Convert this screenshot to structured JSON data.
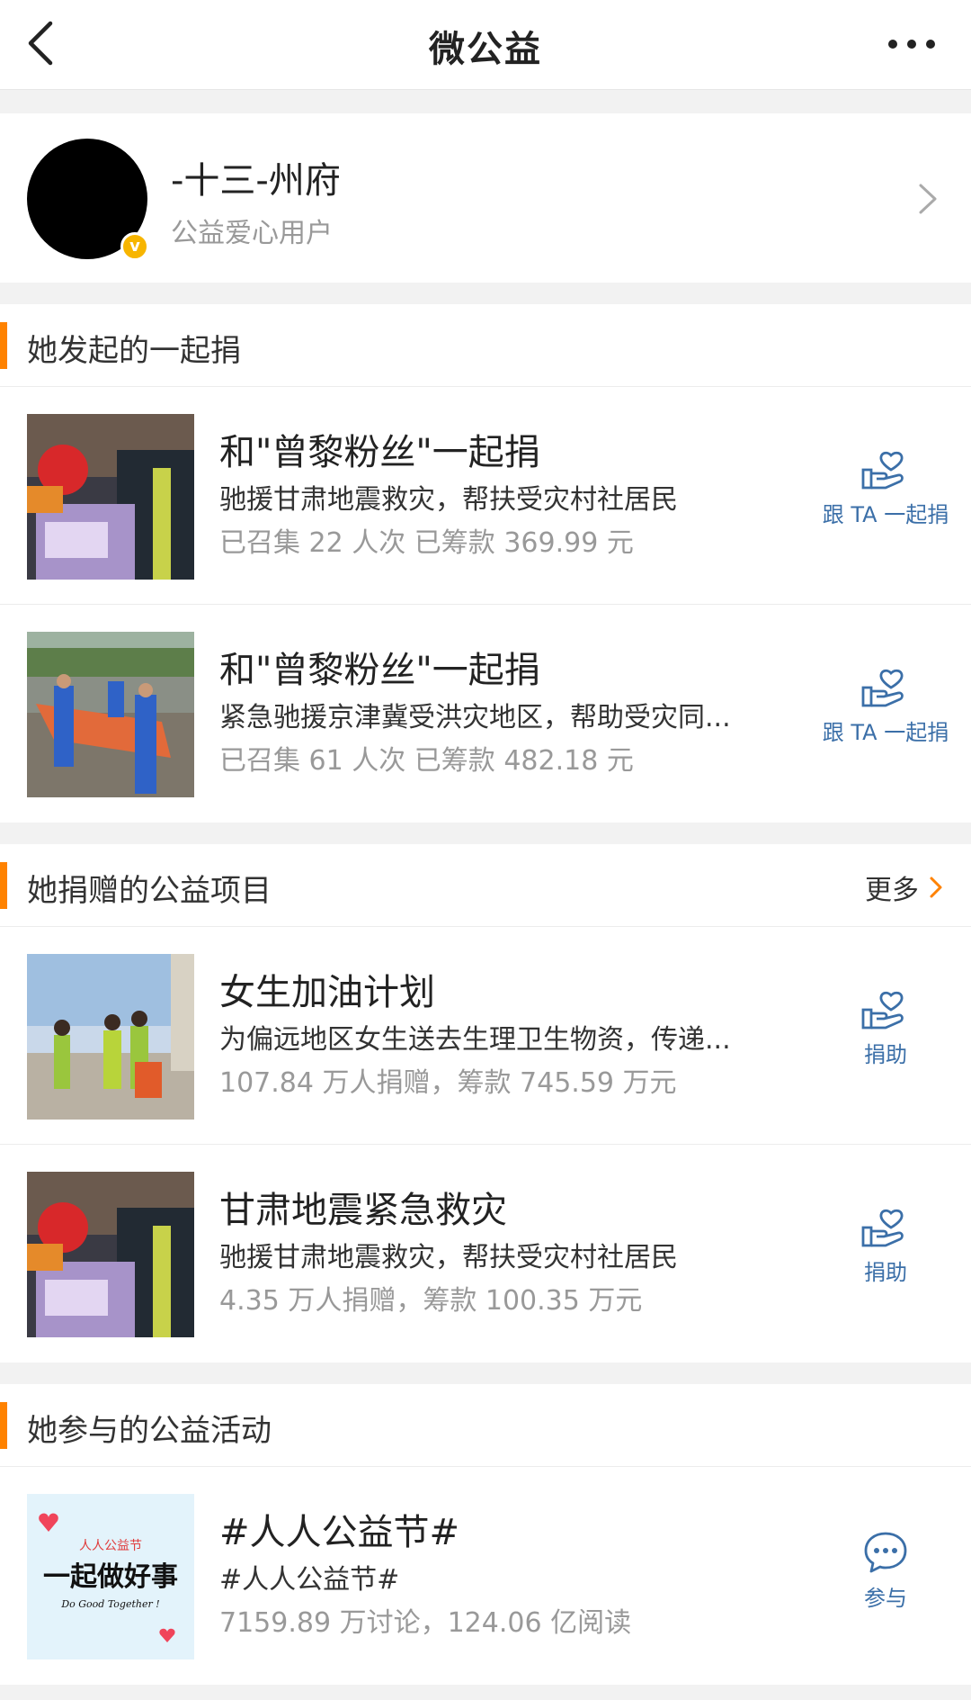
{
  "header": {
    "title": "微公益"
  },
  "profile": {
    "name": "-十三-州府",
    "subtitle": "公益爱心用户",
    "badge": "v"
  },
  "section1": {
    "title": "她发起的一起捐",
    "items": [
      {
        "title": "和\"曾黎粉丝\"一起捐",
        "desc": "驰援甘肃地震救灾，帮扶受灾村社居民",
        "stat": "已召集 22 人次  已筹款 369.99 元",
        "action": "跟 TA 一起捐"
      },
      {
        "title": "和\"曾黎粉丝\"一起捐",
        "desc": "紧急驰援京津冀受洪灾地区，帮助受灾同...",
        "stat": "已召集 61 人次  已筹款 482.18 元",
        "action": "跟 TA 一起捐"
      }
    ]
  },
  "section2": {
    "title": "她捐赠的公益项目",
    "more": "更多",
    "items": [
      {
        "title": "女生加油计划",
        "desc": "为偏远地区女生送去生理卫生物资，传递...",
        "stat": "107.84 万人捐赠，筹款 745.59 万元",
        "action": "捐助"
      },
      {
        "title": "甘肃地震紧急救灾",
        "desc": "驰援甘肃地震救灾，帮扶受灾村社居民",
        "stat": "4.35 万人捐赠，筹款 100.35 万元",
        "action": "捐助"
      }
    ]
  },
  "section3": {
    "title": "她参与的公益活动",
    "items": [
      {
        "title": "#人人公益节#",
        "desc": "#人人公益节#",
        "stat": "7159.89 万讨论，124.06 亿阅读",
        "action": "参与"
      }
    ],
    "poster": {
      "brand": "人人公益节",
      "slogan": "一起做好事",
      "tagline": "Do Good Together !"
    }
  },
  "colors": {
    "accent": "#ff8200",
    "link": "#3b6fa8",
    "badge": "#f7b500"
  }
}
